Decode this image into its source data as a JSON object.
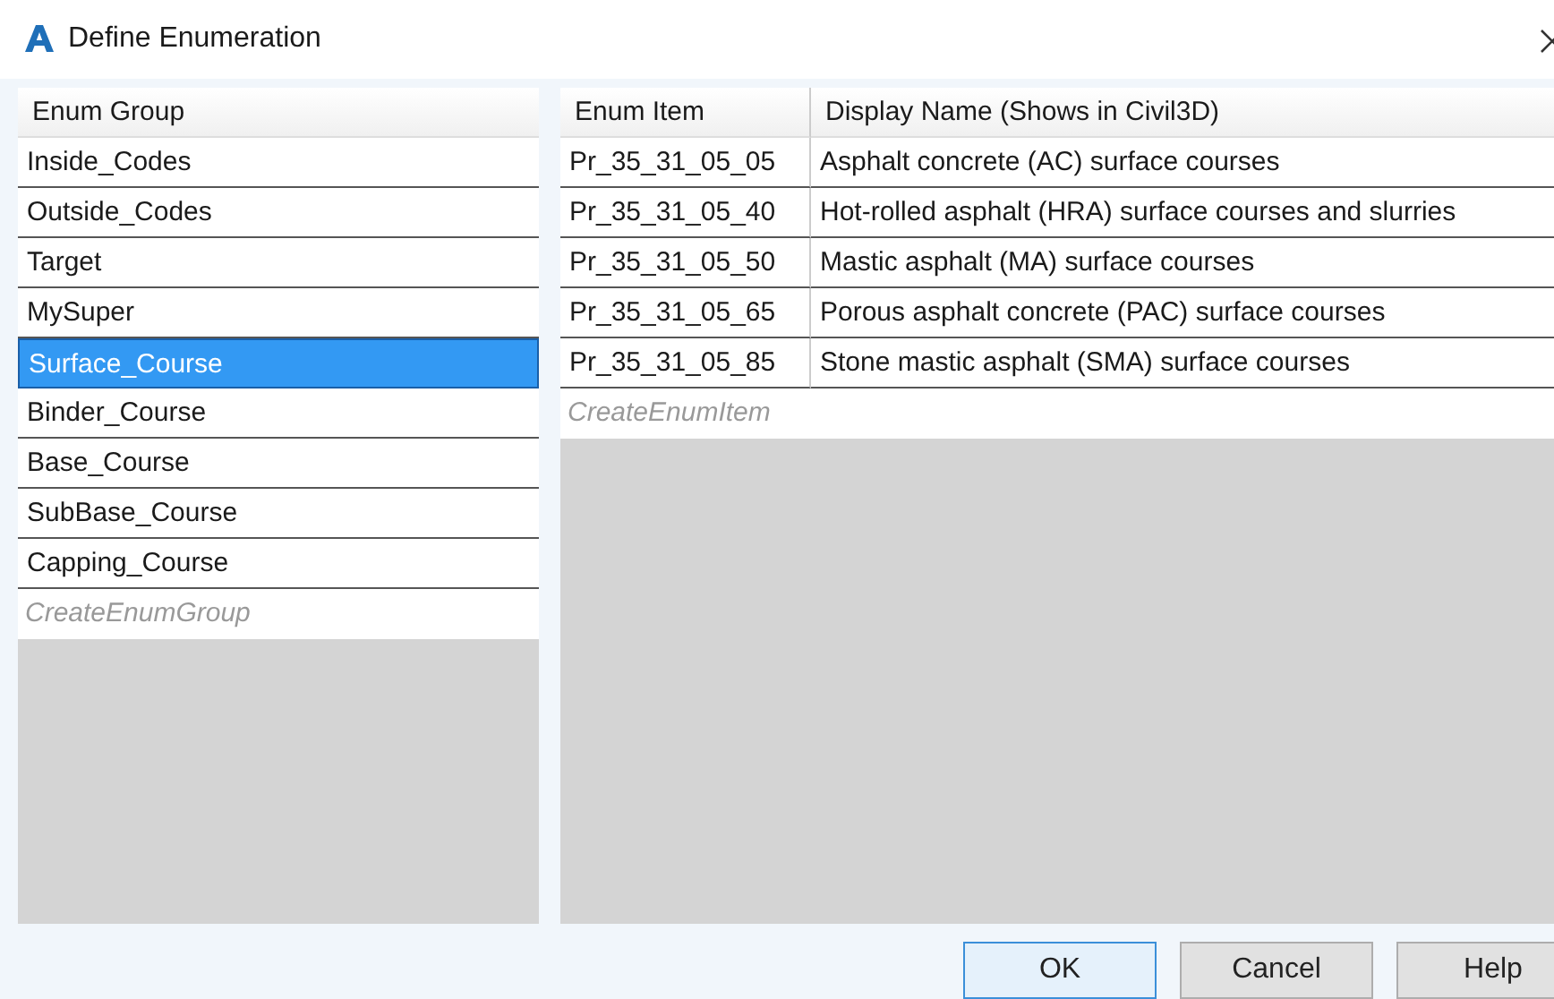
{
  "window": {
    "title": "Define Enumeration"
  },
  "groups": {
    "header": "Enum Group",
    "rows": [
      {
        "label": "Inside_Codes",
        "selected": false
      },
      {
        "label": "Outside_Codes",
        "selected": false
      },
      {
        "label": "Target",
        "selected": false
      },
      {
        "label": "MySuper",
        "selected": false
      },
      {
        "label": "Surface_Course",
        "selected": true
      },
      {
        "label": "Binder_Course",
        "selected": false
      },
      {
        "label": "Base_Course",
        "selected": false
      },
      {
        "label": "SubBase_Course",
        "selected": false
      },
      {
        "label": "Capping_Course",
        "selected": false
      }
    ],
    "new_row_placeholder": "CreateEnumGroup"
  },
  "items": {
    "columns": [
      "Enum Item",
      "Display Name (Shows in Civil3D)"
    ],
    "rows": [
      [
        "Pr_35_31_05_05",
        "Asphalt concrete (AC) surface courses"
      ],
      [
        "Pr_35_31_05_40",
        "Hot-rolled asphalt (HRA) surface courses and slurries"
      ],
      [
        "Pr_35_31_05_50",
        "Mastic asphalt (MA) surface courses"
      ],
      [
        "Pr_35_31_05_65",
        "Porous asphalt concrete (PAC) surface courses"
      ],
      [
        "Pr_35_31_05_85",
        "Stone mastic asphalt (SMA) surface courses"
      ]
    ],
    "new_row_placeholder": "CreateEnumItem"
  },
  "buttons": [
    {
      "label": "OK",
      "default": true
    },
    {
      "label": "Cancel",
      "default": false
    },
    {
      "label": "Help",
      "default": false
    }
  ]
}
